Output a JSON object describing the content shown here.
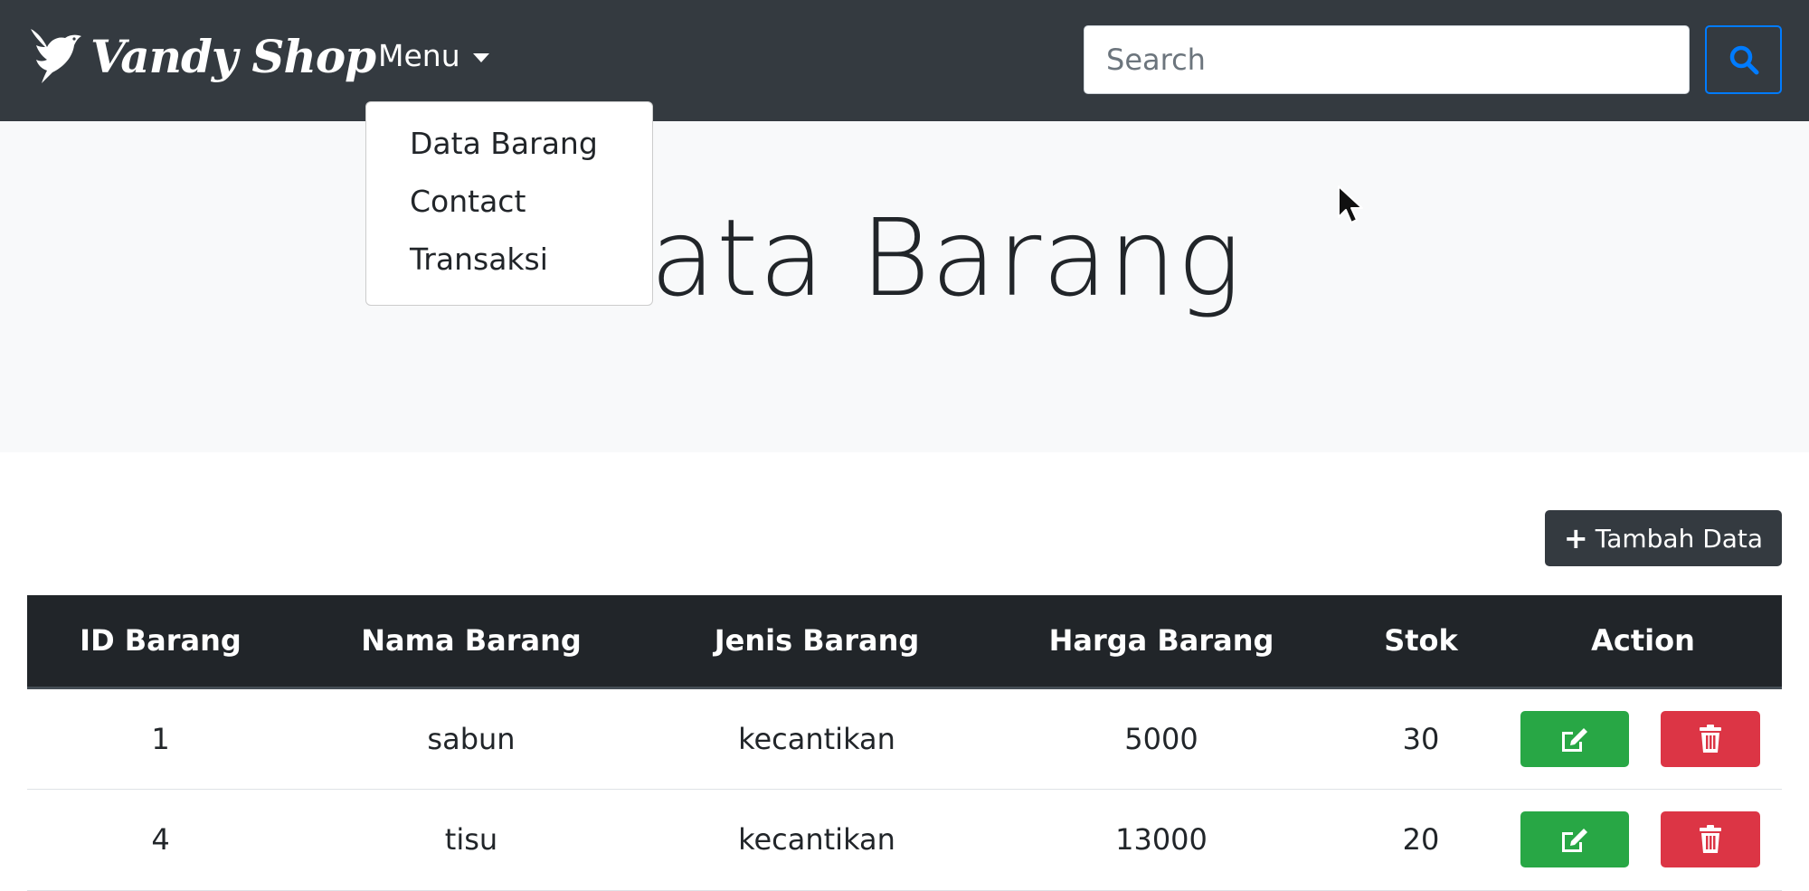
{
  "navbar": {
    "brand_name": "Vandy Shop",
    "menu_label": "Menu",
    "search": {
      "placeholder": "Search",
      "value": ""
    }
  },
  "dropdown": {
    "items": [
      {
        "label": "Data Barang"
      },
      {
        "label": "Contact"
      },
      {
        "label": "Transaksi"
      }
    ]
  },
  "jumbotron": {
    "title": "Data Barang"
  },
  "toolbar": {
    "add_label": "Tambah Data"
  },
  "table": {
    "headers": [
      "ID Barang",
      "Nama Barang",
      "Jenis Barang",
      "Harga Barang",
      "Stok",
      "Action"
    ],
    "rows": [
      {
        "id": "1",
        "nama": "sabun",
        "jenis": "kecantikan",
        "harga": "5000",
        "stok": "30"
      },
      {
        "id": "4",
        "nama": "tisu",
        "jenis": "kecantikan",
        "harga": "13000",
        "stok": "20"
      }
    ]
  },
  "colors": {
    "navbar_bg": "#343a40",
    "jumbotron_bg": "#f8f9fa",
    "table_header_bg": "#212529",
    "search_button_border": "#007bff",
    "edit_button": "#28a745",
    "delete_button": "#dc3545"
  },
  "icons": {
    "brand": "bird-logo-icon",
    "search": "search-icon",
    "add": "plus-icon",
    "edit": "edit-icon",
    "delete": "trash-icon"
  }
}
